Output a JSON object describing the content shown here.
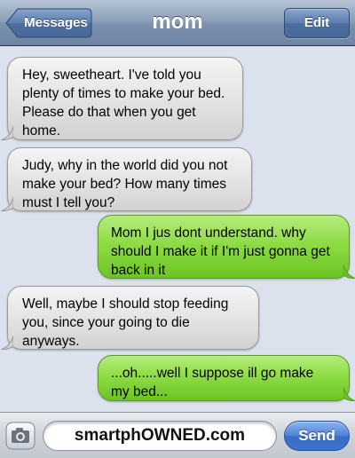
{
  "header": {
    "back_label": "Messages",
    "title": "mom",
    "edit_label": "Edit"
  },
  "messages": [
    {
      "sender": "mom",
      "direction": "incoming",
      "text": "Hey, sweetheart. I've told you plenty of times to make your bed. Please do that when you get home."
    },
    {
      "sender": "mom",
      "direction": "incoming",
      "text": "Judy, why in the world did you not make your bed? How many times must I tell you?"
    },
    {
      "sender": "me",
      "direction": "outgoing",
      "text": "Mom I jus dont understand. why should I make it if I'm just gonna get back in it"
    },
    {
      "sender": "mom",
      "direction": "incoming",
      "text": "Well, maybe I should stop feeding you, since your going to die anyways."
    },
    {
      "sender": "me",
      "direction": "outgoing",
      "text": "...oh.....well I suppose ill go make my bed..."
    }
  ],
  "input": {
    "text": "smartphOWNED.com",
    "send_label": "Send",
    "camera_icon": "camera-icon"
  },
  "colors": {
    "incoming_bubble": "#e6e6e6",
    "outgoing_bubble": "#8edc45",
    "background": "#dbe2ed",
    "send_button": "#4d82d6"
  }
}
